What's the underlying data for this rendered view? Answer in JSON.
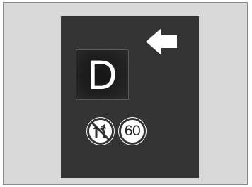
{
  "display": {
    "gear": "D",
    "direction_indicator": "left-arrow-icon",
    "signs": {
      "no_passing": "no-overtaking-sign-icon",
      "speed_limit": "60"
    }
  },
  "colors": {
    "background": "#d9d9d9",
    "display_panel": "#333333",
    "foreground": "#ffffff"
  }
}
